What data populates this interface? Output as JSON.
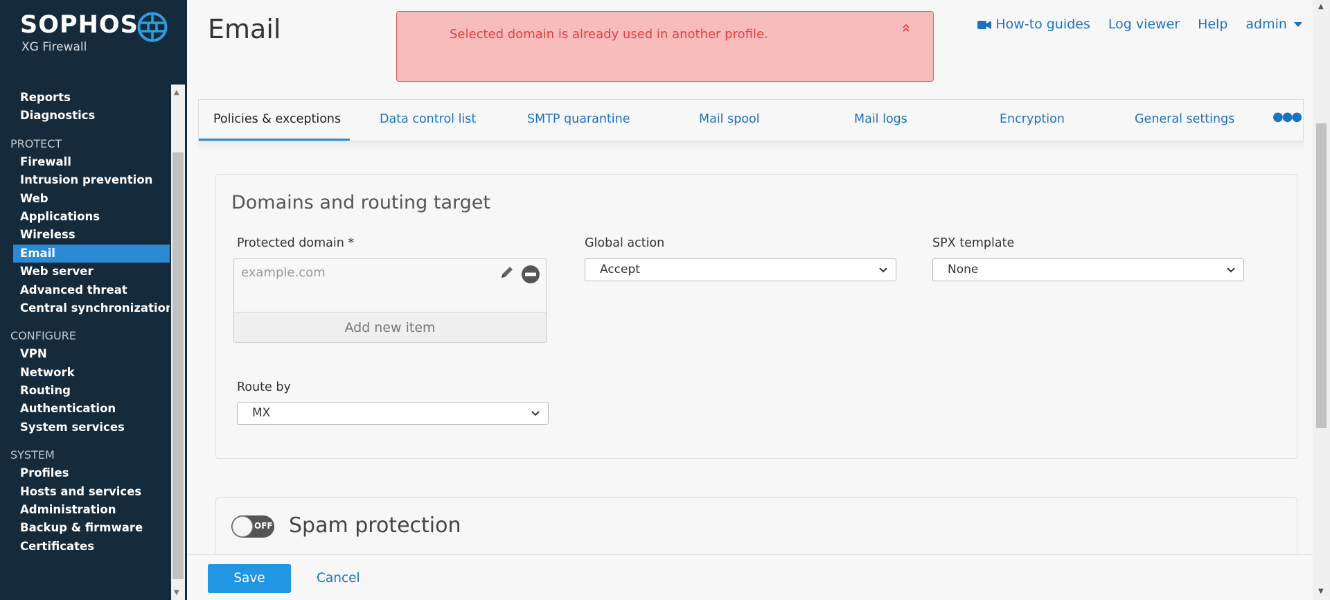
{
  "brand": {
    "name": "SOPHOS",
    "product": "XG Firewall"
  },
  "sidebar": {
    "items_top": [
      "Reports",
      "Diagnostics"
    ],
    "protect_label": "PROTECT",
    "protect_items": [
      "Firewall",
      "Intrusion prevention",
      "Web",
      "Applications",
      "Wireless",
      "Email",
      "Web server",
      "Advanced threat",
      "Central synchronization"
    ],
    "configure_label": "CONFIGURE",
    "configure_items": [
      "VPN",
      "Network",
      "Routing",
      "Authentication",
      "System services"
    ],
    "system_label": "SYSTEM",
    "system_items": [
      "Profiles",
      "Hosts and services",
      "Administration",
      "Backup & firmware",
      "Certificates"
    ],
    "active_item": "Email"
  },
  "header": {
    "title": "Email",
    "alert": "Selected domain is already used in another profile.",
    "links": {
      "howto": "How-to guides",
      "logviewer": "Log viewer",
      "help": "Help",
      "user": "admin"
    }
  },
  "tabs": [
    "Policies & exceptions",
    "Data control list",
    "SMTP quarantine",
    "Mail spool",
    "Mail logs",
    "Encryption",
    "General settings"
  ],
  "active_tab": "Policies & exceptions",
  "domains_panel": {
    "title": "Domains and routing target",
    "protected_domain_label": "Protected domain *",
    "protected_domain_placeholder": "example.com",
    "add_item": "Add new item",
    "global_action_label": "Global action",
    "global_action_value": "Accept",
    "spx_label": "SPX template",
    "spx_value": "None",
    "route_label": "Route by",
    "route_value": "MX"
  },
  "spam_panel": {
    "title": "Spam protection",
    "toggle": "OFF"
  },
  "footer": {
    "save": "Save",
    "cancel": "Cancel"
  },
  "colors": {
    "sidebar_bg": "#152a3b",
    "accent": "#2a8ad4",
    "link": "#1b72c0",
    "alert_bg": "#f8bcbd",
    "alert_text": "#e04040"
  },
  "icons": [
    "sophos-shield-logo",
    "video-camera-icon",
    "caret-down-icon",
    "double-chevron-up-icon",
    "pencil-icon",
    "minus-circle-icon",
    "chevron-down-icon",
    "ellipsis-icon"
  ]
}
